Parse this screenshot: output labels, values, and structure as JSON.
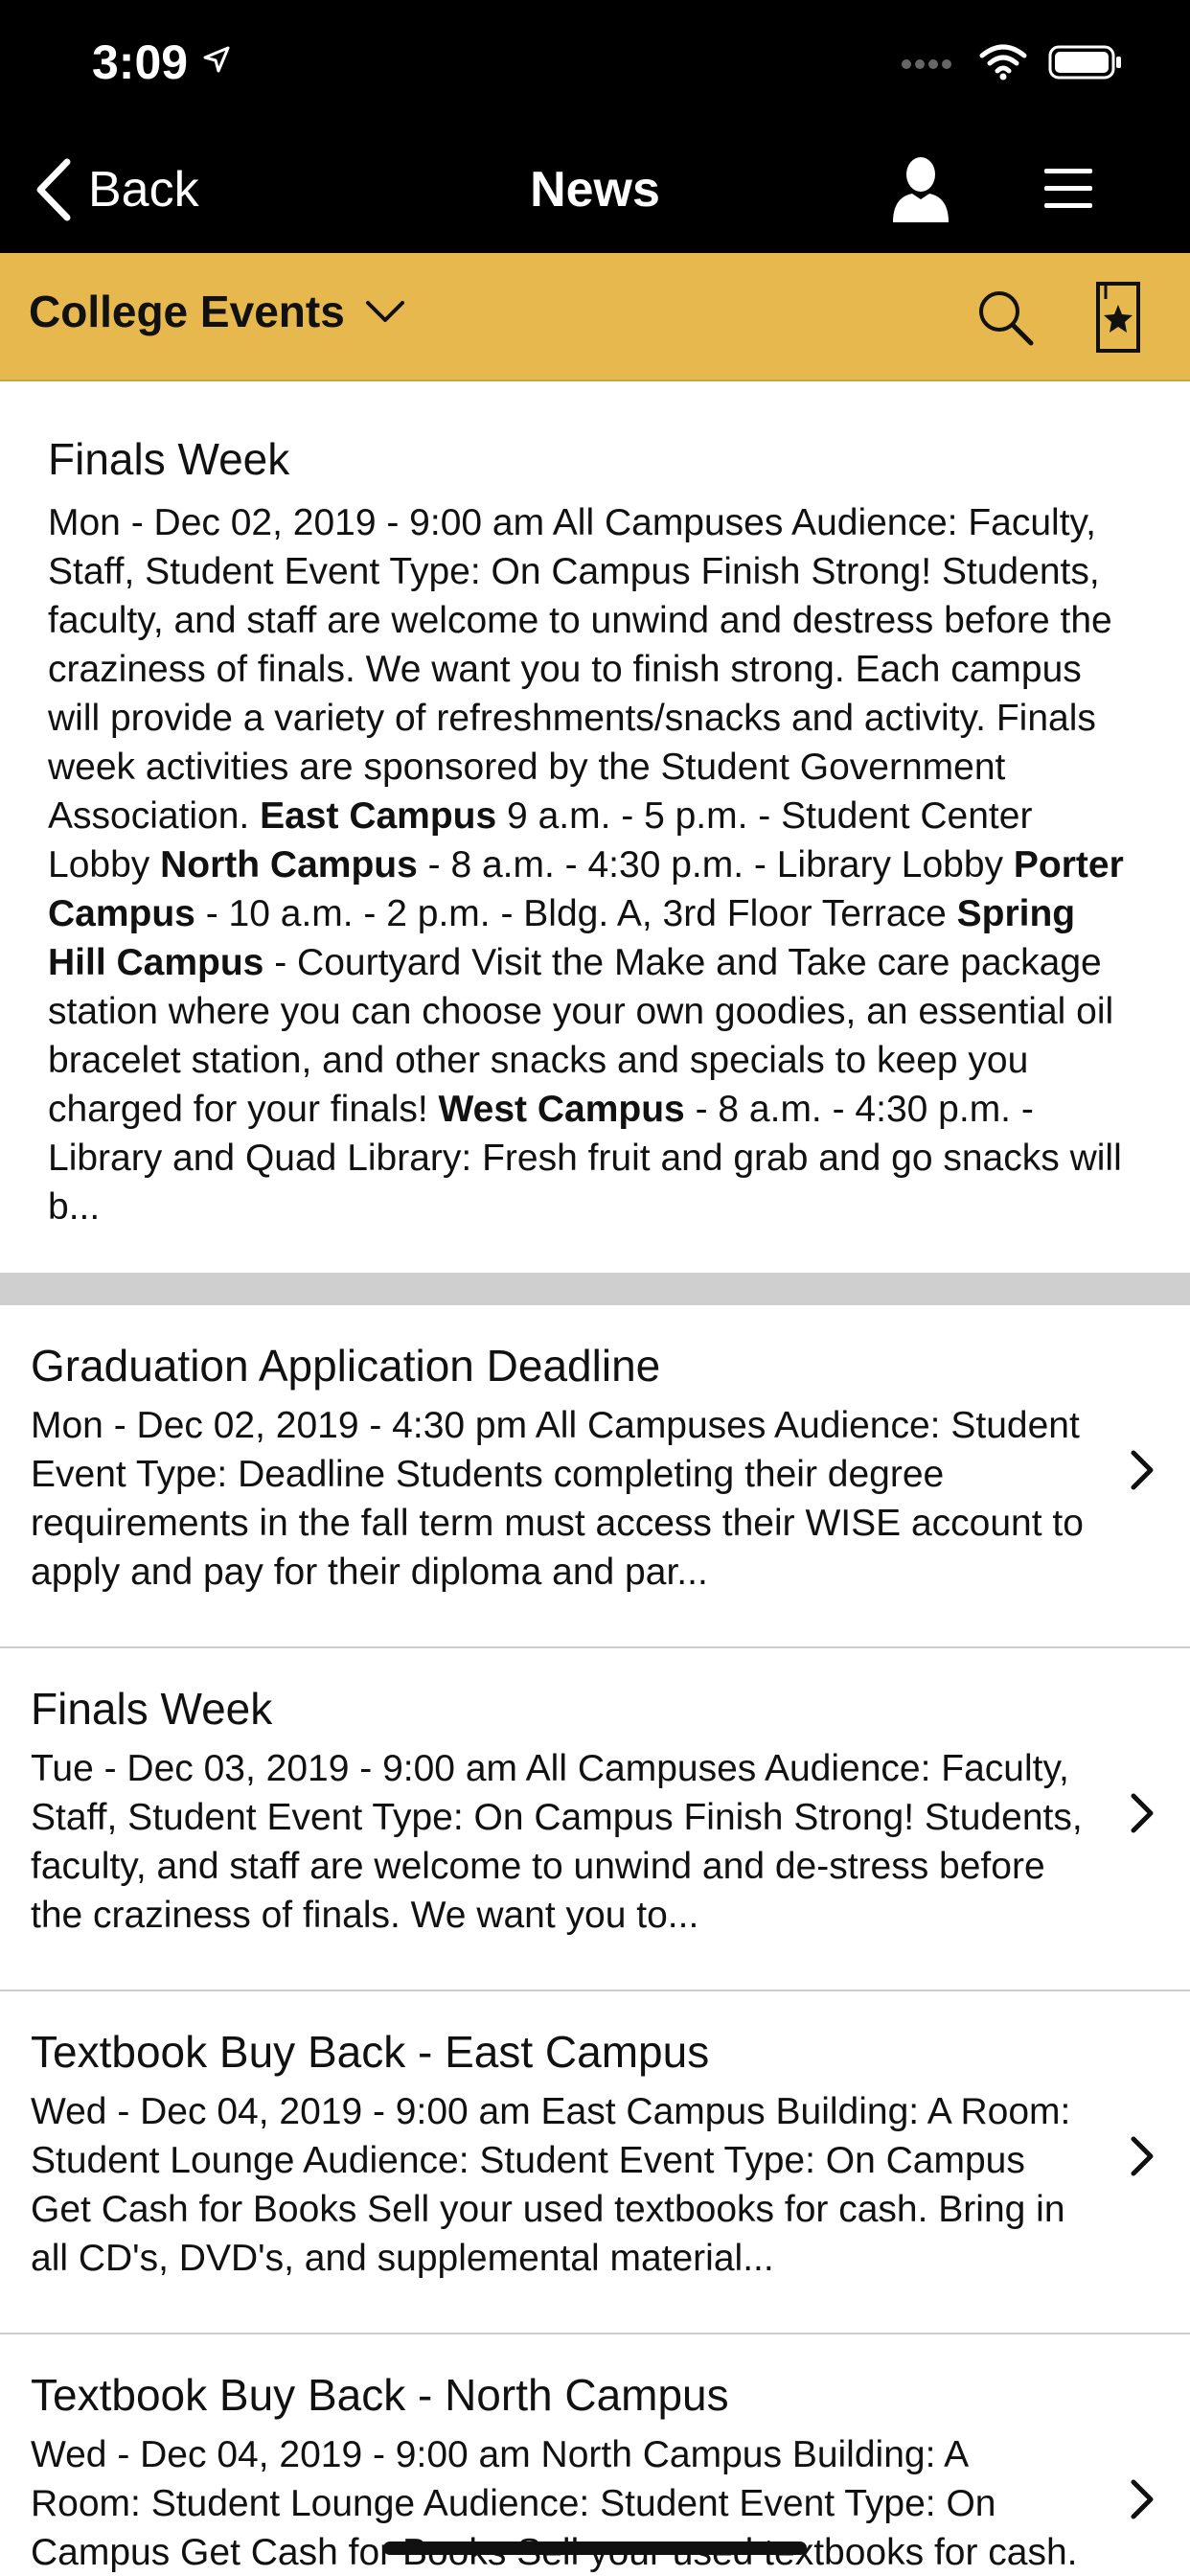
{
  "status_bar": {
    "time": "3:09"
  },
  "nav": {
    "back_label": "Back",
    "title": "News",
    "icons": [
      "chevron-left-icon",
      "user-icon",
      "hamburger-menu-icon"
    ]
  },
  "filter": {
    "category": "College Events",
    "icons": [
      "chevron-down-icon",
      "search-icon",
      "bookmark-star-icon"
    ]
  },
  "featured": {
    "title": "Finals Week",
    "segments": [
      {
        "text": "Mon - Dec 02, 2019 - 9:00 am All Campuses Audience: Fac­ulty, Staff, Student Event Type: On Campus Finish Strong! Students, faculty, and staff are welcome to unwind and de­stress before the craziness of finals. We want you to finish strong. Each campus will provide a variety of refresh­ments/snacks and activity. Finals week activities are spon­sored by the Student Government Association. ",
        "bold": false
      },
      {
        "text": "East Cam­pus",
        "bold": true
      },
      {
        "text": " 9 a.m. - 5 p.m. - Student Center Lobby ",
        "bold": false
      },
      {
        "text": "North Campus",
        "bold": true
      },
      {
        "text": " - 8 a.m. - 4:30 p.m. - Library Lobby ",
        "bold": false
      },
      {
        "text": "Porter Campus",
        "bold": true
      },
      {
        "text": " - 10 a.m. - 2 p.m. - Bldg. A, 3rd Floor Terrace ",
        "bold": false
      },
      {
        "text": "Spring Hill Campus",
        "bold": true
      },
      {
        "text": " - Court­yard Visit the Make and Take care package station where you can choose your own goodies, an essential oil bracelet station, and other snacks and specials to keep you charged for your finals! ",
        "bold": false
      },
      {
        "text": "West Campus",
        "bold": true
      },
      {
        "text": " - 8 a.m. - 4:30 p.m. - Library and Quad Library: Fresh fruit and grab and go snacks will b...",
        "bold": false
      }
    ]
  },
  "list": [
    {
      "title": "Graduation Application Deadline",
      "snippet": "Mon - Dec 02, 2019 - 4:30 pm All Campuses Audience: Student Event Type: Deadline Students completing their degree requirements in the fall term must access their WISE account to apply and pay for their diploma and par..."
    },
    {
      "title": "Finals Week",
      "snippet": "Tue - Dec 03, 2019 - 9:00 am All Campuses Audience: Fac­ulty, Staff, Student Event Type: On Campus Finish Strong! Students, faculty, and staff are welcome to unwind and de-stress before the craziness of finals. We want you to..."
    },
    {
      "title": "Textbook Buy Back - East Campus",
      "snippet": "Wed - Dec 04, 2019 - 9:00 am East Campus Building: A Room: Student Lounge Audience: Student Event Type: On Campus Get Cash for Books Sell your used textbooks for cash. Bring in all CD's, DVD's, and supplemental material..."
    },
    {
      "title": "Textbook Buy Back - North Campus",
      "snippet": "Wed - Dec 04, 2019 - 9:00 am North Campus Building: A Room: Student Lounge Audience: Student Event Type: On Campus Get Cash for Books Sell your used textbooks for cash."
    }
  ],
  "colors": {
    "header_bg": "#000000",
    "filter_bg": "#e6b84e",
    "separator": "#cfcfcf"
  }
}
